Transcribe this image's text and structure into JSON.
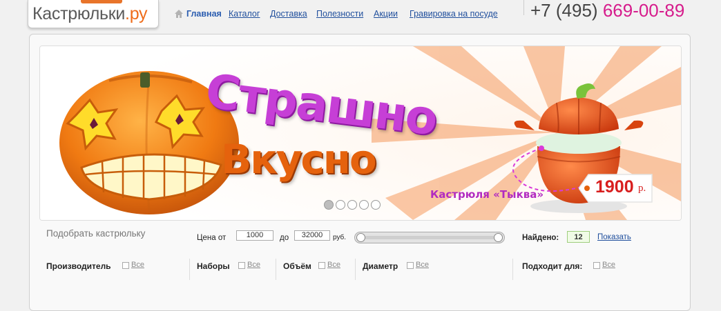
{
  "logo": {
    "text_part1": "Кастрюльки",
    "text_part2": ".ру"
  },
  "nav": {
    "home_icon": "home-icon",
    "items": [
      "Главная",
      "Каталог",
      "Доставка",
      "Полезности",
      "Акции",
      "Гравировка на посуде"
    ]
  },
  "phone": {
    "code": "+7 (495)",
    "number": "669-00-89"
  },
  "banner": {
    "headline1": "Страшно",
    "headline2": "Вкусно",
    "product_name": "Кастрюля «Тыква»",
    "price": "1900",
    "price_currency": "р.",
    "slides_count": 5,
    "active_slide": 1
  },
  "filter": {
    "title": "Подобрать кастрюльку",
    "price_label": "Цена от",
    "price_to_label": "до",
    "price_from": "1000",
    "price_to": "32000",
    "currency": "руб.",
    "found_label": "Найдено:",
    "found_count": "12",
    "show_label": "Показать",
    "categories": [
      {
        "label": "Производитель",
        "option": "Все"
      },
      {
        "label": "Наборы",
        "option": "Все"
      },
      {
        "label": "Объём",
        "option": "Все"
      },
      {
        "label": "Диаметр",
        "option": "Все"
      },
      {
        "label": "Подходит для:",
        "option": "Все"
      }
    ]
  },
  "colors": {
    "accent_orange": "#ef6c1a",
    "phone_pink": "#d61c8c",
    "link_blue": "#1f4e9c",
    "headline_magenta": "#c63fd6",
    "headline_orange": "#e5620d"
  }
}
